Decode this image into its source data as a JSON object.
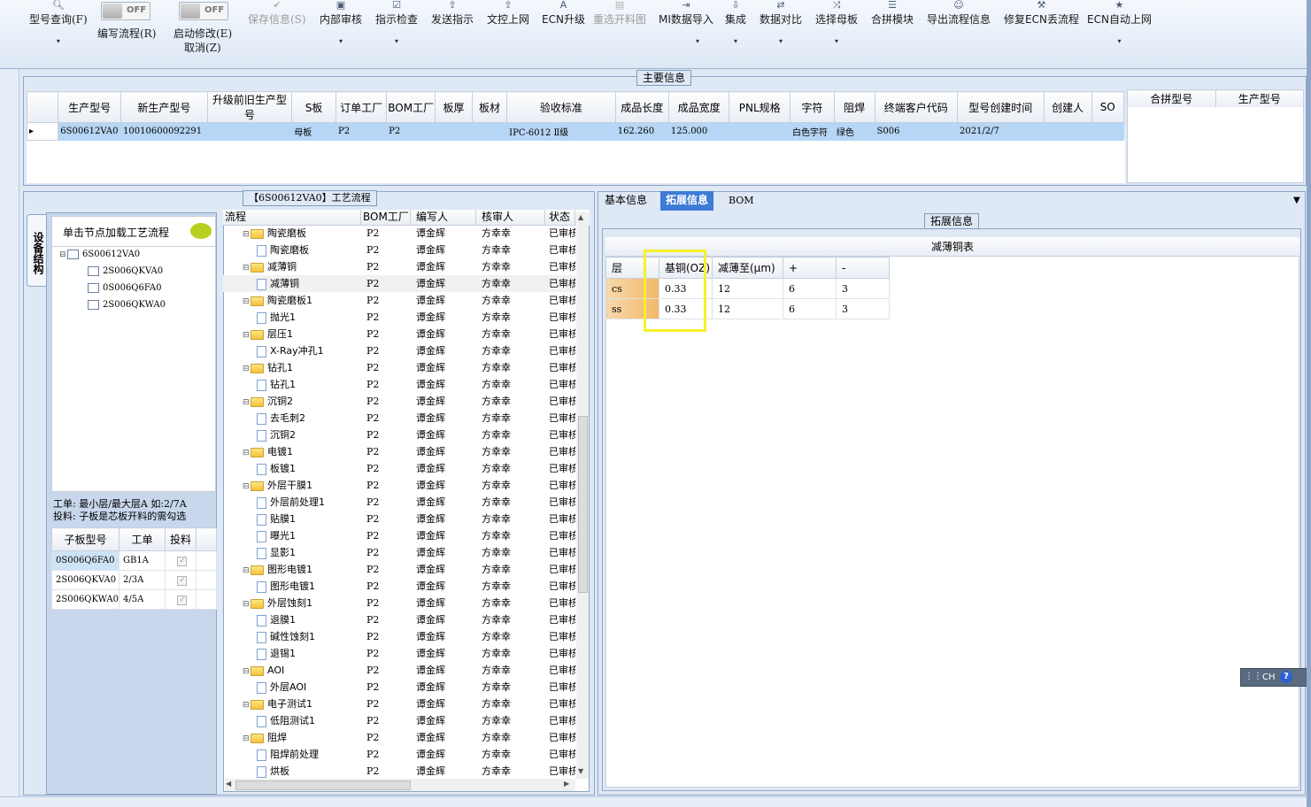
{
  "toolbar": {
    "buttons": [
      {
        "label": "型号查询(F)",
        "icon": "search-icon",
        "enabled": true
      },
      {
        "label": "编写流程(R)",
        "enabled": true
      },
      {
        "label": "启动修改(E)",
        "enabled": true
      },
      {
        "label": "取消(Z)",
        "enabled": true
      },
      {
        "label": "保存信息(S)",
        "icon": "check-icon",
        "enabled": false
      },
      {
        "label": "内部审核",
        "icon": "print-icon",
        "enabled": true
      },
      {
        "label": "指示检查",
        "icon": "checklist-icon",
        "enabled": true
      },
      {
        "label": "发送指示",
        "icon": "upload-icon",
        "enabled": true
      },
      {
        "label": "文控上网",
        "icon": "upload-icon",
        "enabled": true
      },
      {
        "label": "ECN升级",
        "icon": "letter-a-icon",
        "enabled": true
      },
      {
        "label": "重选开料图",
        "icon": "image-icon",
        "enabled": false
      },
      {
        "label": "MI数据导入",
        "icon": "import-icon",
        "enabled": true
      },
      {
        "label": "集成",
        "icon": "download-icon",
        "enabled": true
      },
      {
        "label": "数据对比",
        "icon": "compare-icon",
        "enabled": true
      },
      {
        "label": "选择母板",
        "icon": "shuffle-icon",
        "enabled": true
      },
      {
        "label": "合拼模块",
        "icon": "list-icon",
        "enabled": true
      },
      {
        "label": "导出流程信息",
        "icon": "smiley-icon",
        "enabled": true
      },
      {
        "label": "修复ECN丢流程",
        "icon": "wrench-icon",
        "enabled": true
      },
      {
        "label": "ECN自动上网",
        "icon": "star-icon",
        "enabled": true
      }
    ],
    "toggle_off": "OFF"
  },
  "main_info": {
    "title": "主要信息",
    "columns": [
      "生产型号",
      "新生产型号",
      "升级前旧生产型号",
      "S板",
      "订单工厂",
      "BOM工厂",
      "板厚",
      "板材",
      "验收标准",
      "成品长度",
      "成品宽度",
      "PNL规格",
      "字符",
      "阻焊",
      "终端客户代码",
      "型号创建时间",
      "创建人",
      "SO"
    ],
    "row": [
      "6S00612VA0",
      "10010600092291",
      "",
      "母板",
      "P2",
      "P2",
      "",
      "",
      "IPC-6012 Ⅱ级",
      "162.260",
      "125.000",
      "",
      "白色字符",
      "绿色",
      "S006",
      "2021/2/7",
      "",
      ""
    ],
    "side_columns": [
      "合拼型号",
      "生产型号"
    ]
  },
  "flow_panel": {
    "title": "【6S00612VA0】工艺流程",
    "vertical_tab": "设备结构",
    "tree_hint": "单击节点加载工艺流程",
    "tree": {
      "root": "6S00612VA0",
      "children": [
        "2S006QKVA0",
        "0S006Q6FA0",
        "2S006QKWA0"
      ]
    },
    "notes": [
      "工单: 最小层/最大层A 如:2/7A",
      "投料: 子板是芯板开料的需勾选"
    ],
    "sub_columns": [
      "子板型号",
      "工单",
      "投料"
    ],
    "sub_rows": [
      {
        "model": "0S006Q6FA0",
        "order": "GB1A",
        "feed": true
      },
      {
        "model": "2S006QKVA0",
        "order": "2/3A",
        "feed": true
      },
      {
        "model": "2S006QKWA0",
        "order": "4/5A",
        "feed": true
      }
    ],
    "grid_columns": [
      "流程",
      "BOM工厂",
      "编写人",
      "核审人",
      "状态"
    ],
    "grid_rows": [
      {
        "name": "陶瓷磨板",
        "kind": "folder",
        "bom": "P2",
        "writer": "谭金辉",
        "reviewer": "方幸幸",
        "status": "已审核"
      },
      {
        "name": "陶瓷磨板",
        "kind": "doc",
        "bom": "P2",
        "writer": "谭金辉",
        "reviewer": "方幸幸",
        "status": "已审核"
      },
      {
        "name": "减薄铜",
        "kind": "folder",
        "bom": "P2",
        "writer": "谭金辉",
        "reviewer": "方幸幸",
        "status": "已审核"
      },
      {
        "name": "减薄铜",
        "kind": "doc",
        "bom": "P2",
        "writer": "谭金辉",
        "reviewer": "方幸幸",
        "status": "已审核"
      },
      {
        "name": "陶瓷磨板1",
        "kind": "folder",
        "bom": "P2",
        "writer": "谭金辉",
        "reviewer": "方幸幸",
        "status": "已审核"
      },
      {
        "name": "抛光1",
        "kind": "doc",
        "bom": "P2",
        "writer": "谭金辉",
        "reviewer": "方幸幸",
        "status": "已审核"
      },
      {
        "name": "层压1",
        "kind": "folder",
        "bom": "P2",
        "writer": "谭金辉",
        "reviewer": "方幸幸",
        "status": "已审核"
      },
      {
        "name": "X-Ray冲孔1",
        "kind": "doc",
        "bom": "P2",
        "writer": "谭金辉",
        "reviewer": "方幸幸",
        "status": "已审核"
      },
      {
        "name": "钻孔1",
        "kind": "folder",
        "bom": "P2",
        "writer": "谭金辉",
        "reviewer": "方幸幸",
        "status": "已审核"
      },
      {
        "name": "钻孔1",
        "kind": "doc",
        "bom": "P2",
        "writer": "谭金辉",
        "reviewer": "方幸幸",
        "status": "已审核"
      },
      {
        "name": "沉铜2",
        "kind": "folder",
        "bom": "P2",
        "writer": "谭金辉",
        "reviewer": "方幸幸",
        "status": "已审核"
      },
      {
        "name": "去毛刺2",
        "kind": "doc",
        "bom": "P2",
        "writer": "谭金辉",
        "reviewer": "方幸幸",
        "status": "已审核"
      },
      {
        "name": "沉铜2",
        "kind": "doc",
        "bom": "P2",
        "writer": "谭金辉",
        "reviewer": "方幸幸",
        "status": "已审核"
      },
      {
        "name": "电镀1",
        "kind": "folder",
        "bom": "P2",
        "writer": "谭金辉",
        "reviewer": "方幸幸",
        "status": "已审核"
      },
      {
        "name": "板镀1",
        "kind": "doc",
        "bom": "P2",
        "writer": "谭金辉",
        "reviewer": "方幸幸",
        "status": "已审核"
      },
      {
        "name": "外层干膜1",
        "kind": "folder",
        "bom": "P2",
        "writer": "谭金辉",
        "reviewer": "方幸幸",
        "status": "已审核"
      },
      {
        "name": "外层前处理1",
        "kind": "doc",
        "bom": "P2",
        "writer": "谭金辉",
        "reviewer": "方幸幸",
        "status": "已审核"
      },
      {
        "name": "贴膜1",
        "kind": "doc",
        "bom": "P2",
        "writer": "谭金辉",
        "reviewer": "方幸幸",
        "status": "已审核"
      },
      {
        "name": "曝光1",
        "kind": "doc",
        "bom": "P2",
        "writer": "谭金辉",
        "reviewer": "方幸幸",
        "status": "已审核"
      },
      {
        "name": "显影1",
        "kind": "doc",
        "bom": "P2",
        "writer": "谭金辉",
        "reviewer": "方幸幸",
        "status": "已审核"
      },
      {
        "name": "图形电镀1",
        "kind": "folder",
        "bom": "P2",
        "writer": "谭金辉",
        "reviewer": "方幸幸",
        "status": "已审核"
      },
      {
        "name": "图形电镀1",
        "kind": "doc",
        "bom": "P2",
        "writer": "谭金辉",
        "reviewer": "方幸幸",
        "status": "已审核"
      },
      {
        "name": "外层蚀刻1",
        "kind": "folder",
        "bom": "P2",
        "writer": "谭金辉",
        "reviewer": "方幸幸",
        "status": "已审核"
      },
      {
        "name": "退膜1",
        "kind": "doc",
        "bom": "P2",
        "writer": "谭金辉",
        "reviewer": "方幸幸",
        "status": "已审核"
      },
      {
        "name": "碱性蚀刻1",
        "kind": "doc",
        "bom": "P2",
        "writer": "谭金辉",
        "reviewer": "方幸幸",
        "status": "已审核"
      },
      {
        "name": "退锡1",
        "kind": "doc",
        "bom": "P2",
        "writer": "谭金辉",
        "reviewer": "方幸幸",
        "status": "已审核"
      },
      {
        "name": "AOI",
        "kind": "folder",
        "bom": "P2",
        "writer": "谭金辉",
        "reviewer": "方幸幸",
        "status": "已审核"
      },
      {
        "name": "外层AOI",
        "kind": "doc",
        "bom": "P2",
        "writer": "谭金辉",
        "reviewer": "方幸幸",
        "status": "已审核"
      },
      {
        "name": "电子测试1",
        "kind": "folder",
        "bom": "P2",
        "writer": "谭金辉",
        "reviewer": "方幸幸",
        "status": "已审核"
      },
      {
        "name": "低阻测试1",
        "kind": "doc",
        "bom": "P2",
        "writer": "谭金辉",
        "reviewer": "方幸幸",
        "status": "已审核"
      },
      {
        "name": "阻焊",
        "kind": "folder",
        "bom": "P2",
        "writer": "谭金辉",
        "reviewer": "方幸幸",
        "status": "已审核"
      },
      {
        "name": "阻焊前处理",
        "kind": "doc",
        "bom": "P2",
        "writer": "谭金辉",
        "reviewer": "方幸幸",
        "status": "已审核"
      },
      {
        "name": "烘板",
        "kind": "doc",
        "bom": "P2",
        "writer": "谭金辉",
        "reviewer": "方幸幸",
        "status": "已审核"
      }
    ]
  },
  "right_panel": {
    "tabs": [
      "基本信息",
      "拓展信息",
      "BOM"
    ],
    "active_tab": "拓展信息",
    "section_title": "拓展信息",
    "table_title": "减薄铜表",
    "columns": [
      "层",
      "基铜(OZ)",
      "减薄至(μm)",
      "+",
      "-"
    ],
    "rows": [
      [
        "cs",
        "0.33",
        "12",
        "6",
        "3"
      ],
      [
        "ss",
        "0.33",
        "12",
        "6",
        "3"
      ]
    ]
  },
  "ime": {
    "label": "CH",
    "help": "?"
  },
  "colors": {
    "selection": "#b7d6f5",
    "active_tab": "#3d7bd6",
    "highlight_box": "#f5f22c"
  }
}
